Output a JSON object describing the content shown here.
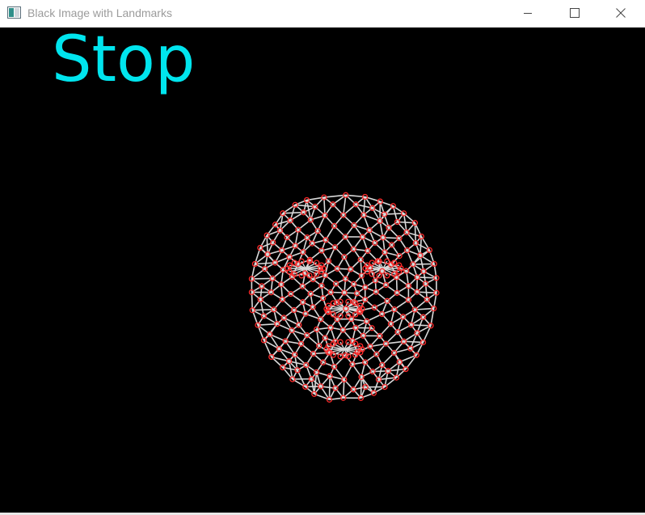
{
  "window": {
    "title": "Black Image with Landmarks",
    "controls": [
      "minimize-icon",
      "maximize-icon",
      "close-icon"
    ]
  },
  "canvas": {
    "background": "#000000",
    "overlay_text": "Stop",
    "overlay_color": "#00e5ee",
    "mesh_line_color": "#d9d9d9",
    "landmark_color": "#ff2a2a"
  }
}
